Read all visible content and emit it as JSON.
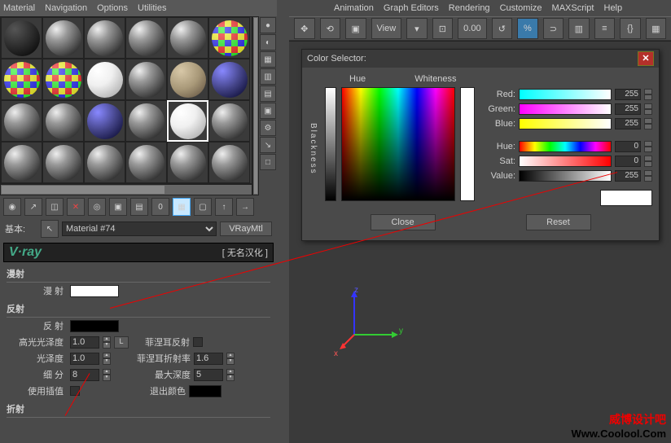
{
  "left_menu": {
    "material": "Material",
    "navigation": "Navigation",
    "options": "Options",
    "utilities": "Utilities"
  },
  "vp_menu": {
    "animation": "Animation",
    "graph": "Graph Editors",
    "rendering": "Rendering",
    "customize": "Customize",
    "maxscript": "MAXScript",
    "help": "Help"
  },
  "vp_toolbar": {
    "view_label": "View",
    "coord_value": "0.00"
  },
  "mat_row": {
    "basic": "基本:",
    "name": "Material #74",
    "type": "VRayMtl"
  },
  "vray_header": {
    "logo": "V·ray",
    "credit": "[ 无名汉化 ]"
  },
  "rollout": {
    "diffuse_title": "漫射",
    "diffuse_label": "漫  射",
    "reflect_title": "反射",
    "reflect_label": "反  射",
    "hilight_gloss": "高光光泽度",
    "hilight_val": "1.0",
    "lock_btn": "L",
    "fresnel": "菲涅耳反射",
    "refl_gloss": "光泽度",
    "refl_gloss_val": "1.0",
    "fresnel_ior": "菲涅耳折射率",
    "fresnel_ior_val": "1.6",
    "subdivs": "细  分",
    "subdivs_val": "8",
    "max_depth": "最大深度",
    "max_depth_val": "5",
    "use_interp": "使用插值",
    "exit_color": "退出颜色",
    "refract_title": "折射"
  },
  "color_selector": {
    "title": "Color Selector:",
    "hue": "Hue",
    "whiteness": "Whiteness",
    "blackness": "Blackness",
    "red": "Red:",
    "green": "Green:",
    "blue": "Blue:",
    "huel": "Hue:",
    "sat": "Sat:",
    "value": "Value:",
    "rv": "255",
    "gv": "255",
    "bv": "255",
    "hv": "0",
    "sv": "0",
    "vv": "255",
    "close": "Close",
    "reset": "Reset"
  },
  "gizmo": {
    "x": "x",
    "y": "y",
    "z": "z"
  },
  "watermark": {
    "line1": "威博设计吧",
    "line2": "Www.Coolool.Com"
  }
}
